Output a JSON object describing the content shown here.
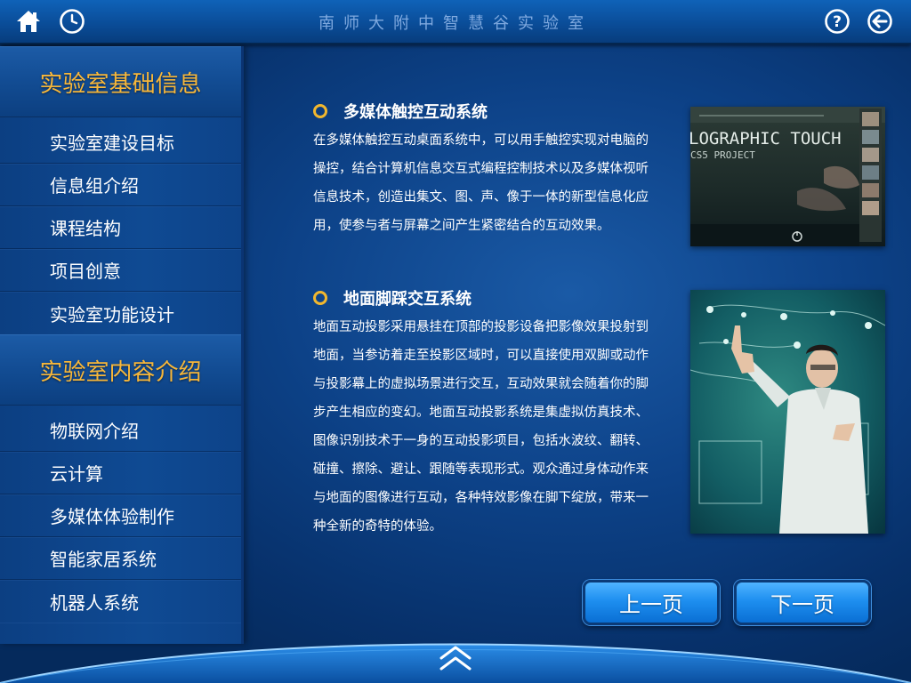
{
  "header": {
    "title": "南师大附中智慧谷实验室",
    "home_icon": "home-icon",
    "clock_icon": "clock-icon",
    "help_icon": "help-icon",
    "back_icon": "back-arrow-icon"
  },
  "sidebar": {
    "group1": {
      "title": "实验室基础信息",
      "items": [
        "实验室建设目标",
        "信息组介绍",
        "课程结构",
        "项目创意",
        "实验室功能设计"
      ]
    },
    "group2": {
      "title": "实验室内容介绍",
      "items": [
        "物联网介绍",
        "云计算",
        "多媒体体验制作",
        "智能家居系统",
        "机器人系统"
      ]
    }
  },
  "content": {
    "section1": {
      "title": "多媒体触控互动系统",
      "body": "在多媒体触控互动桌面系统中，可以用手触控实现对电脑的操控，结合计算机信息交互式编程控制技术以及多媒体视听信息技术，创造出集文、图、声、像于一体的新型信息化应用，使参与者与屏幕之间产生紧密结合的互动效果。",
      "image_text": {
        "line1": "LOGRAPHIC TOUCH",
        "line2": "CS5 PROJECT"
      }
    },
    "section2": {
      "title": "地面脚踩交互系统",
      "body": "地面互动投影采用悬挂在顶部的投影设备把影像效果投射到地面，当参访着走至投影区域时，可以直接使用双脚或动作与投影幕上的虚拟场景进行交互，互动效果就会随着你的脚步产生相应的变幻。地面互动投影系统是集虚拟仿真技术、图像识别技术于一身的互动投影项目，包括水波纹、翻转、碰撞、擦除、避让、跟随等表现形式。观众通过身体动作来与地面的图像进行互动，各种特效影像在脚下绽放，带来一种全新的奇特的体验。"
    }
  },
  "nav": {
    "prev_label": "上一页",
    "next_label": "下一页"
  },
  "colors": {
    "accent": "#f1b72e",
    "background": "#07316b",
    "button": "#1e8ff0"
  }
}
